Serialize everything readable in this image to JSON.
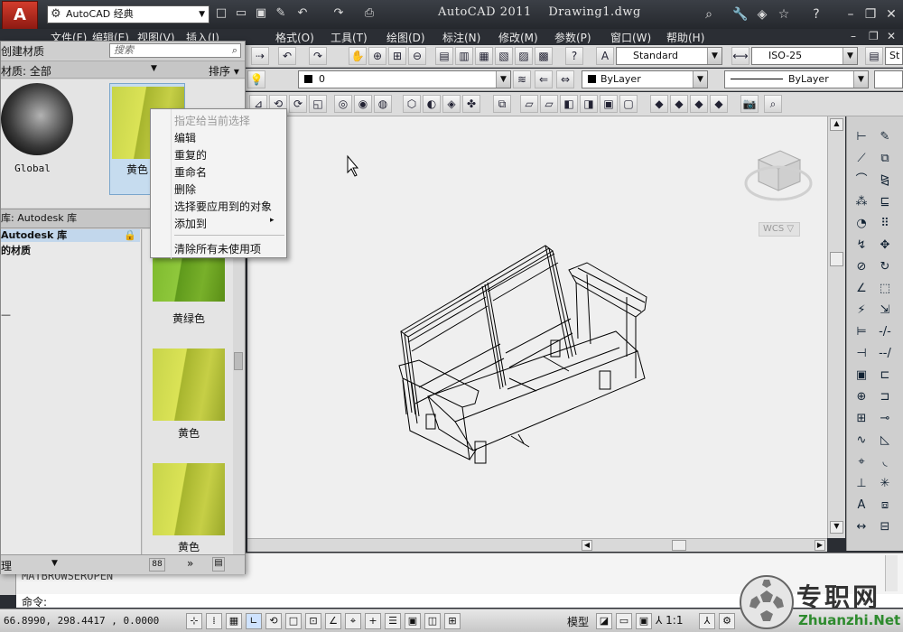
{
  "titlebar": {
    "app_icon": "A",
    "workspace": "AutoCAD 经典",
    "app_name": "AutoCAD 2011",
    "document": "Drawing1.dwg"
  },
  "menus": [
    "文件(F)",
    "编辑(E)",
    "视图(V)",
    "插入(I)",
    "格式(O)",
    "工具(T)",
    "绘图(D)",
    "标注(N)",
    "修改(M)",
    "参数(P)",
    "窗口(W)",
    "帮助(H)"
  ],
  "toolbar": {
    "text_style": "Standard",
    "dim_style": "ISO-25",
    "table_style_partial": "St",
    "layer": "0",
    "color": "ByLayer",
    "linetype": "ByLayer"
  },
  "material_panel": {
    "create_label": "创建材质",
    "search_placeholder": "搜索",
    "filter_label": "材质: 全部",
    "sort_label": "排序",
    "doc_materials": [
      {
        "name": "Global"
      },
      {
        "name": "黄色"
      }
    ],
    "library_header": "库: Autodesk 库",
    "tree_items": [
      "Autodesk 库",
      "的材质",
      "—"
    ],
    "library_materials": [
      {
        "name": "黄绿色"
      },
      {
        "name": "黄色"
      },
      {
        "name": "黄色"
      }
    ],
    "bottom_left": "理",
    "bottom_icons": [
      "88",
      "»"
    ]
  },
  "context_menu": {
    "items": [
      {
        "label": "指定给当前选择",
        "disabled": true
      },
      {
        "label": "编辑"
      },
      {
        "label": "重复的"
      },
      {
        "label": "重命名"
      },
      {
        "label": "删除"
      },
      {
        "label": "选择要应用到的对象"
      },
      {
        "label": "添加到",
        "submenu": true
      },
      {
        "label": "清除所有未使用项"
      }
    ]
  },
  "viewcube": {
    "wcs": "WCS"
  },
  "command": {
    "history": "MATBROWSEROPEN",
    "prompt": "命令:"
  },
  "status": {
    "coords": "66.8990,  298.4417 , 0.0000",
    "model_label": "模型",
    "scale": "1:1"
  },
  "watermark": {
    "title": "专职网",
    "url": "Zhuanzhi.Net"
  }
}
